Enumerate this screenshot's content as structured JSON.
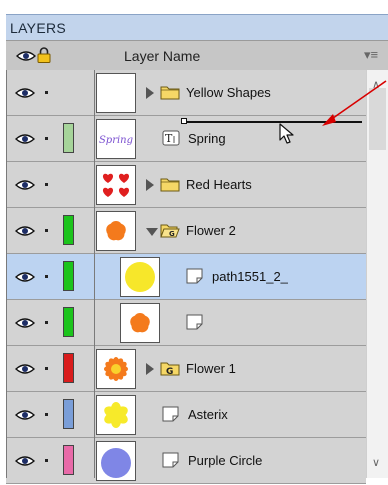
{
  "panel": {
    "title": "LAYERS"
  },
  "header": {
    "column_label": "Layer Name",
    "menu_glyph": "▾≡"
  },
  "scrollbar": {
    "up_glyph": "∧",
    "down_glyph": "∨"
  },
  "colors": {
    "row_bg": "#d3d3d3",
    "selected_bg": "#bcd3f1",
    "titlebar_bg": "#c2d4ec",
    "annotation_red": "#d80000"
  },
  "thumb_text": {
    "spring": "Spring"
  },
  "layers": [
    {
      "name": "Yellow Shapes",
      "swatch": "",
      "kind": "folder",
      "expanded": false,
      "selected": false,
      "thumb": "blank"
    },
    {
      "name": "Spring",
      "swatch": "#a6d49a",
      "kind": "text-layer",
      "selected": false,
      "thumb": "spring"
    },
    {
      "name": "Red Hearts",
      "swatch": "",
      "kind": "folder",
      "expanded": false,
      "selected": false,
      "thumb": "hearts"
    },
    {
      "name": "Flower 2",
      "swatch": "#1cc41c",
      "kind": "folder-open",
      "expanded": true,
      "selected": false,
      "thumb": "flower-orange"
    },
    {
      "name": "path1551_2_",
      "swatch": "#1cc41c",
      "kind": "path",
      "selected": true,
      "thumb": "circle-yellow"
    },
    {
      "name": "",
      "swatch": "#1cc41c",
      "kind": "path",
      "selected": false,
      "thumb": "flower-orange"
    },
    {
      "name": "Flower 1",
      "swatch": "#d91c1c",
      "kind": "group",
      "expanded": false,
      "selected": false,
      "thumb": "sun-orange"
    },
    {
      "name": "Asterix",
      "swatch": "#7a9ed8",
      "kind": "path",
      "selected": false,
      "thumb": "asterix-yellow"
    },
    {
      "name": "Purple Circle",
      "swatch": "#e86aa8",
      "kind": "path",
      "selected": false,
      "thumb": "circle-purple"
    }
  ]
}
